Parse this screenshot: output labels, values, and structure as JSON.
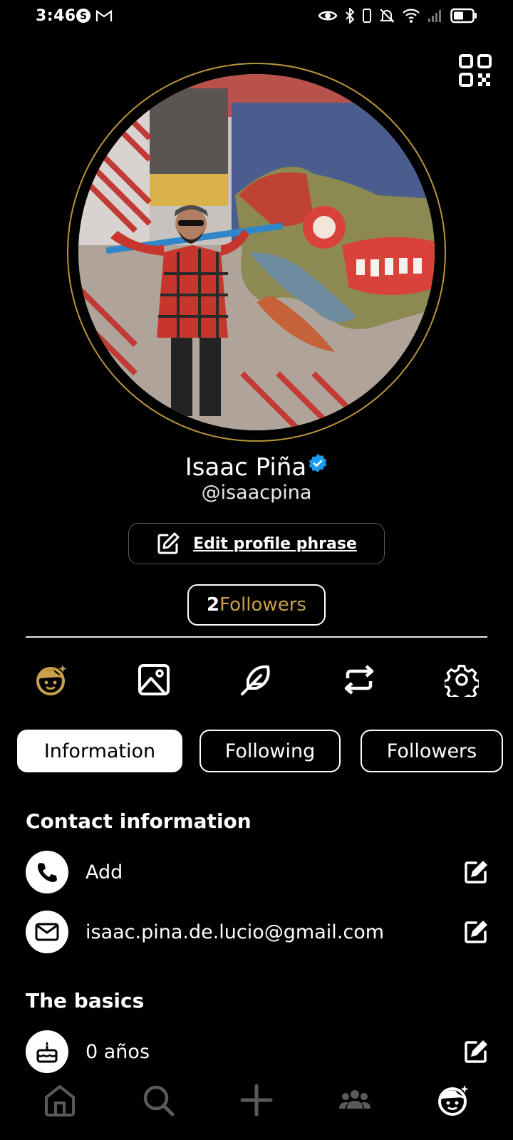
{
  "status_bar": {
    "time": "3:46",
    "icons": [
      "s-app-icon",
      "gmail-icon",
      "eye-icon",
      "bluetooth-icon",
      "vibrate-icon",
      "mute-icon",
      "wifi-icon",
      "signal-icon",
      "battery-icon"
    ]
  },
  "profile": {
    "name": "Isaac Piña",
    "handle": "@isaacpina",
    "verified": true,
    "edit_phrase_label": "Edit profile phrase",
    "followers_count": "2",
    "followers_word": "Followers"
  },
  "icon_row": [
    "profile-face-icon",
    "image-icon",
    "feather-icon",
    "repost-icon",
    "settings-gear-icon"
  ],
  "tabs": [
    {
      "label": "Information",
      "active": true
    },
    {
      "label": "Following",
      "active": false
    },
    {
      "label": "Followers",
      "active": false
    }
  ],
  "contact": {
    "title": "Contact information",
    "phone": "Add",
    "email": "isaac.pina.de.lucio@gmail.com"
  },
  "basics": {
    "title": "The basics",
    "age": "0 años"
  },
  "bottom_nav": [
    "home-icon",
    "search-icon",
    "plus-icon",
    "people-icon",
    "profile-face-icon"
  ],
  "colors": {
    "background": "#000000",
    "accent_gold": "#c9a14a",
    "verified_blue": "#1d9bf0",
    "inactive_nav": "#5a5a5a"
  }
}
